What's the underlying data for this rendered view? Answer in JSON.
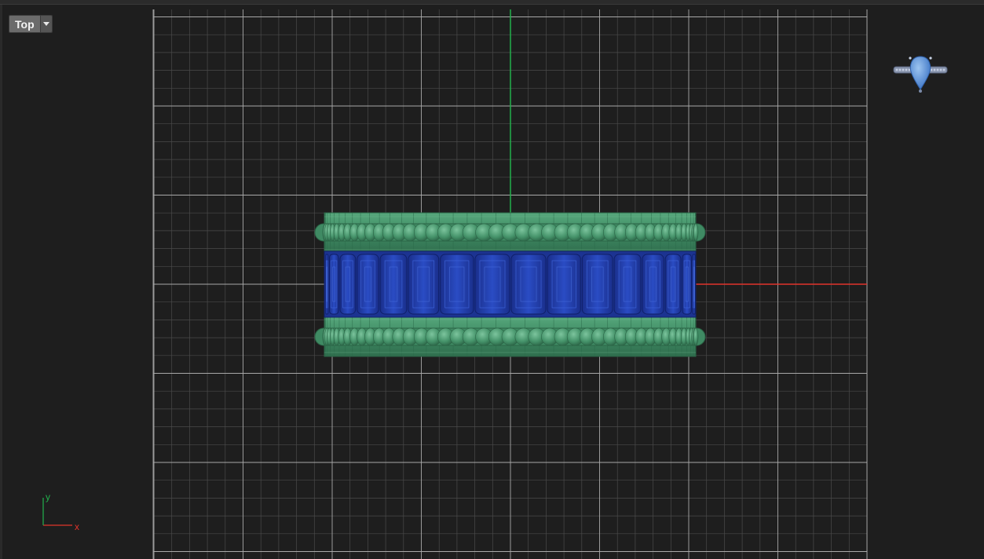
{
  "viewport": {
    "view_label": "Top",
    "dropdown_icon": "chevron-down-icon",
    "axis_triad": {
      "y_label": "y",
      "x_label": "x"
    },
    "navigation_cube_icon": "ring-gizmo-icon"
  },
  "colors": {
    "background": "#1e1e1e",
    "grid_major": "#a8a8a8",
    "grid_minor": "#4a4a4a",
    "x_axis": "#e0342c",
    "y_axis": "#22b14c",
    "metal": "#3f8a63",
    "gem": "#2140b8",
    "gizmo_gem": "#4a86d6"
  }
}
